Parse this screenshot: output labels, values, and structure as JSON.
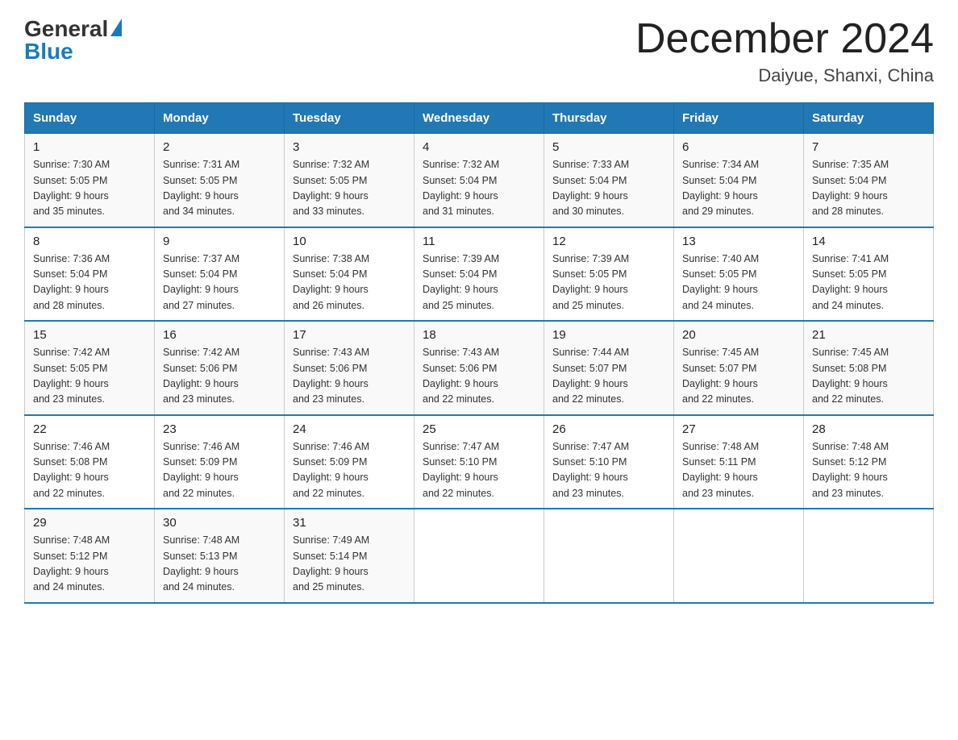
{
  "header": {
    "logo_general": "General",
    "logo_blue": "Blue",
    "month_year": "December 2024",
    "location": "Daiyue, Shanxi, China"
  },
  "columns": [
    "Sunday",
    "Monday",
    "Tuesday",
    "Wednesday",
    "Thursday",
    "Friday",
    "Saturday"
  ],
  "weeks": [
    [
      {
        "day": "1",
        "sunrise": "7:30 AM",
        "sunset": "5:05 PM",
        "daylight": "9 hours and 35 minutes."
      },
      {
        "day": "2",
        "sunrise": "7:31 AM",
        "sunset": "5:05 PM",
        "daylight": "9 hours and 34 minutes."
      },
      {
        "day": "3",
        "sunrise": "7:32 AM",
        "sunset": "5:05 PM",
        "daylight": "9 hours and 33 minutes."
      },
      {
        "day": "4",
        "sunrise": "7:32 AM",
        "sunset": "5:04 PM",
        "daylight": "9 hours and 31 minutes."
      },
      {
        "day": "5",
        "sunrise": "7:33 AM",
        "sunset": "5:04 PM",
        "daylight": "9 hours and 30 minutes."
      },
      {
        "day": "6",
        "sunrise": "7:34 AM",
        "sunset": "5:04 PM",
        "daylight": "9 hours and 29 minutes."
      },
      {
        "day": "7",
        "sunrise": "7:35 AM",
        "sunset": "5:04 PM",
        "daylight": "9 hours and 28 minutes."
      }
    ],
    [
      {
        "day": "8",
        "sunrise": "7:36 AM",
        "sunset": "5:04 PM",
        "daylight": "9 hours and 28 minutes."
      },
      {
        "day": "9",
        "sunrise": "7:37 AM",
        "sunset": "5:04 PM",
        "daylight": "9 hours and 27 minutes."
      },
      {
        "day": "10",
        "sunrise": "7:38 AM",
        "sunset": "5:04 PM",
        "daylight": "9 hours and 26 minutes."
      },
      {
        "day": "11",
        "sunrise": "7:39 AM",
        "sunset": "5:04 PM",
        "daylight": "9 hours and 25 minutes."
      },
      {
        "day": "12",
        "sunrise": "7:39 AM",
        "sunset": "5:05 PM",
        "daylight": "9 hours and 25 minutes."
      },
      {
        "day": "13",
        "sunrise": "7:40 AM",
        "sunset": "5:05 PM",
        "daylight": "9 hours and 24 minutes."
      },
      {
        "day": "14",
        "sunrise": "7:41 AM",
        "sunset": "5:05 PM",
        "daylight": "9 hours and 24 minutes."
      }
    ],
    [
      {
        "day": "15",
        "sunrise": "7:42 AM",
        "sunset": "5:05 PM",
        "daylight": "9 hours and 23 minutes."
      },
      {
        "day": "16",
        "sunrise": "7:42 AM",
        "sunset": "5:06 PM",
        "daylight": "9 hours and 23 minutes."
      },
      {
        "day": "17",
        "sunrise": "7:43 AM",
        "sunset": "5:06 PM",
        "daylight": "9 hours and 23 minutes."
      },
      {
        "day": "18",
        "sunrise": "7:43 AM",
        "sunset": "5:06 PM",
        "daylight": "9 hours and 22 minutes."
      },
      {
        "day": "19",
        "sunrise": "7:44 AM",
        "sunset": "5:07 PM",
        "daylight": "9 hours and 22 minutes."
      },
      {
        "day": "20",
        "sunrise": "7:45 AM",
        "sunset": "5:07 PM",
        "daylight": "9 hours and 22 minutes."
      },
      {
        "day": "21",
        "sunrise": "7:45 AM",
        "sunset": "5:08 PM",
        "daylight": "9 hours and 22 minutes."
      }
    ],
    [
      {
        "day": "22",
        "sunrise": "7:46 AM",
        "sunset": "5:08 PM",
        "daylight": "9 hours and 22 minutes."
      },
      {
        "day": "23",
        "sunrise": "7:46 AM",
        "sunset": "5:09 PM",
        "daylight": "9 hours and 22 minutes."
      },
      {
        "day": "24",
        "sunrise": "7:46 AM",
        "sunset": "5:09 PM",
        "daylight": "9 hours and 22 minutes."
      },
      {
        "day": "25",
        "sunrise": "7:47 AM",
        "sunset": "5:10 PM",
        "daylight": "9 hours and 22 minutes."
      },
      {
        "day": "26",
        "sunrise": "7:47 AM",
        "sunset": "5:10 PM",
        "daylight": "9 hours and 23 minutes."
      },
      {
        "day": "27",
        "sunrise": "7:48 AM",
        "sunset": "5:11 PM",
        "daylight": "9 hours and 23 minutes."
      },
      {
        "day": "28",
        "sunrise": "7:48 AM",
        "sunset": "5:12 PM",
        "daylight": "9 hours and 23 minutes."
      }
    ],
    [
      {
        "day": "29",
        "sunrise": "7:48 AM",
        "sunset": "5:12 PM",
        "daylight": "9 hours and 24 minutes."
      },
      {
        "day": "30",
        "sunrise": "7:48 AM",
        "sunset": "5:13 PM",
        "daylight": "9 hours and 24 minutes."
      },
      {
        "day": "31",
        "sunrise": "7:49 AM",
        "sunset": "5:14 PM",
        "daylight": "9 hours and 25 minutes."
      },
      null,
      null,
      null,
      null
    ]
  ],
  "labels": {
    "sunrise": "Sunrise:",
    "sunset": "Sunset:",
    "daylight": "Daylight:"
  }
}
